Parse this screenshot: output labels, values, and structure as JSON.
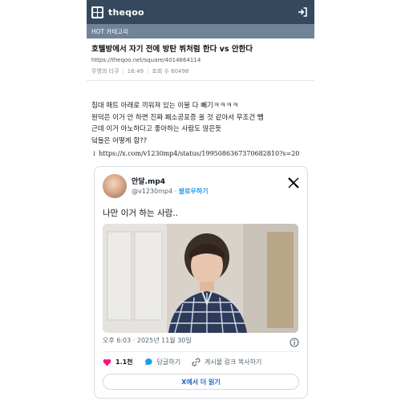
{
  "header": {
    "site_name": "theqoo"
  },
  "category": {
    "label": "HOT 카테고리"
  },
  "post": {
    "title": "호텔방에서 자기 전에 방탄 뷔처럼 한다 vs 안한다",
    "url": "https://theqoo.net/square/4014664114",
    "author": "무명의 더쿠",
    "time": "16:49",
    "views": "조회 수 60498",
    "body_lines": [
      "침대 매트 아래로 끼워져 있는 이불 다 빼기ㅋㅋㅋㅋ",
      "원덕은 이거 안 하면 진짜 폐소공포증 올 것 같아서 무조건 뺌",
      "근데 이거 아노하다고 좋아하는 사람도 많은듯",
      "덬들은 어떻게 함??"
    ],
    "link": "↓ https://x.com/v1230mp4/status/1995086367370682810?s=20"
  },
  "tweet": {
    "display_name": "안달.mp4",
    "handle": "@v1230mp4",
    "separator": "·",
    "follow_label": "팔로우하기",
    "text": "나만 이거 하는 사람..",
    "timestamp": "오후 6:03 · 2025년 11월 30일",
    "like_count": "1.1천",
    "reply_label": "답글하기",
    "copy_label": "게시물 링크 복사하기",
    "read_more_label": "X에서 더 읽기"
  },
  "colors": {
    "header_bg": "#34495e",
    "category_bg": "#6f8399",
    "like": "#f91880",
    "reply": "#1d9bf0",
    "link_blue": "#1d63c4"
  }
}
